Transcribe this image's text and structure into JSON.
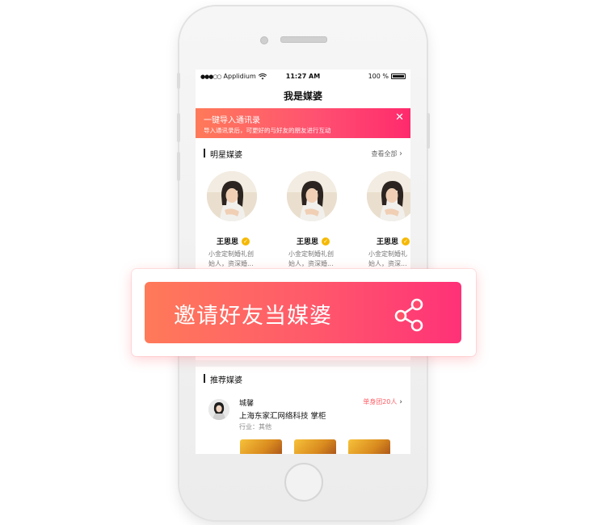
{
  "status_bar": {
    "carrier": "Applidium",
    "time": "11:27 AM",
    "battery": "100 %"
  },
  "nav": {
    "title": "我是媒婆"
  },
  "banner": {
    "title": "一键导入通讯录",
    "subtitle": "导入通讯录后，可更好的与好友的朋友进行互动",
    "close_icon": "close-icon"
  },
  "star_section": {
    "title": "明星媒婆",
    "more": "查看全部",
    "cards": [
      {
        "name": "王思思",
        "desc_line1": "小金定制婚礼创",
        "desc_line2": "始人，资深婚..."
      },
      {
        "name": "王思思",
        "desc_line1": "小金定制婚礼创",
        "desc_line2": "始人，资深婚..."
      },
      {
        "name": "王思思",
        "desc_line1": "小金定制婚礼",
        "desc_line2": "始人，资深..."
      }
    ]
  },
  "invite": {
    "label": "邀请好友当媒婆",
    "icon": "share-icon"
  },
  "recommend_section": {
    "title": "推荐媒婆",
    "items": [
      {
        "name": "城馨",
        "company": "上海东家汇网络科技 掌柜",
        "industry": "行业：其他",
        "badge": "单身团20人"
      }
    ]
  },
  "colors": {
    "accent_start": "#ff7a59",
    "accent_end": "#ff3178",
    "verified": "#f5b800"
  }
}
